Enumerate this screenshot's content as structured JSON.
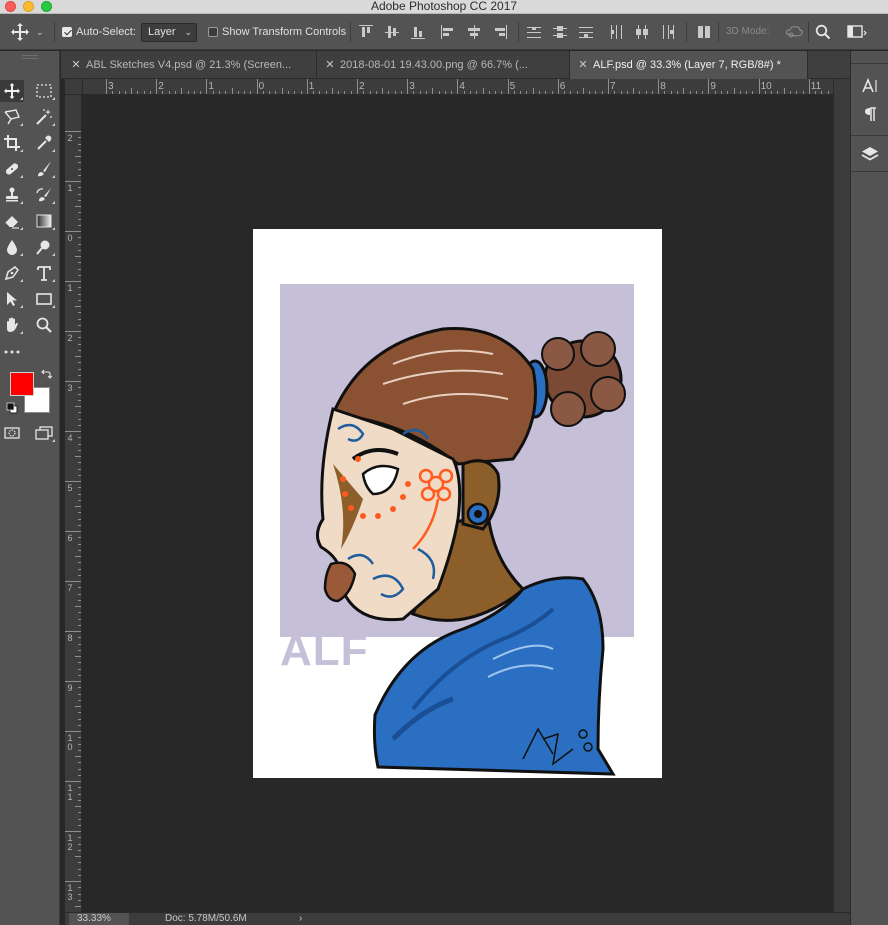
{
  "window": {
    "title": "Adobe Photoshop CC 2017"
  },
  "options_bar": {
    "auto_select_label": "Auto-Select:",
    "auto_select_checked": true,
    "auto_select_target": "Layer",
    "show_transform_label": "Show Transform Controls",
    "show_transform_checked": false,
    "mode_3d_label": "3D Mode:"
  },
  "tabs": [
    {
      "label": "ABL Sketches V4.psd @ 21.3% (Screen...",
      "active": false
    },
    {
      "label": "2018-08-01 19.43.00.png @ 66.7% (...",
      "active": false
    },
    {
      "label": "ALF.psd @ 33.3% (Layer 7, RGB/8#) *",
      "active": true
    }
  ],
  "ruler_top_numbers": [
    "3",
    "2",
    "1",
    "0",
    "1",
    "2",
    "3",
    "4",
    "5",
    "6",
    "7",
    "8",
    "9",
    "10",
    "11"
  ],
  "ruler_left_numbers": [
    "2",
    "1",
    "0",
    "1",
    "2",
    "3",
    "4",
    "5",
    "6",
    "7",
    "8",
    "9",
    "10",
    "11",
    "12",
    "13"
  ],
  "artwork": {
    "caption": "ALF"
  },
  "colors": {
    "foreground": "#ff0000",
    "background": "#ffffff",
    "canvas_bg": "#282828",
    "panel_bg": "#535353"
  },
  "tools": [
    "move-tool",
    "marquee-tool",
    "lasso-tool",
    "magic-wand-tool",
    "crop-tool",
    "eyedropper-tool",
    "healing-brush-tool",
    "brush-tool",
    "clone-stamp-tool",
    "history-brush-tool",
    "eraser-tool",
    "gradient-tool",
    "blur-tool",
    "dodge-tool",
    "pen-tool",
    "type-tool",
    "path-selection-tool",
    "rectangle-tool",
    "hand-tool",
    "zoom-tool",
    "more-tools"
  ],
  "status": {
    "zoom": "33.33%",
    "doc": "Doc: 5.78M/50.6M",
    "arrow": "›"
  }
}
